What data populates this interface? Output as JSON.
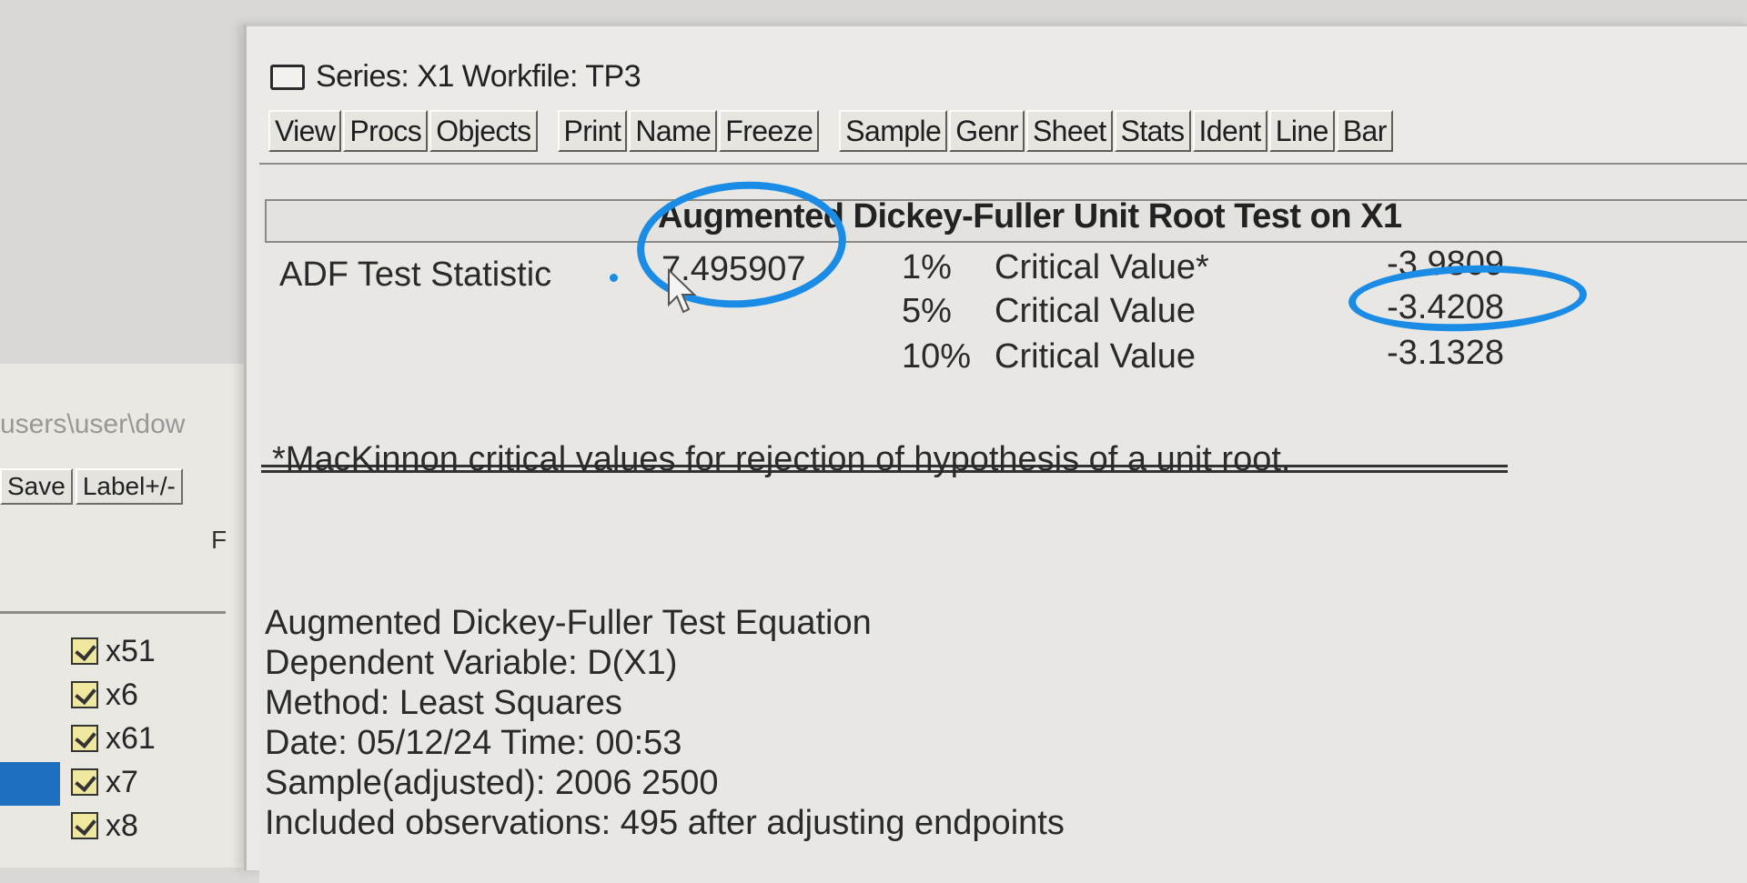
{
  "background_window": {
    "path": "users\\user\\dow",
    "toolbar": [
      "Save",
      "Label+/-"
    ],
    "cut_letter": "F",
    "items": [
      "x51",
      "x6",
      "x61",
      "x7",
      "x8"
    ]
  },
  "window": {
    "title": "Series: X1   Workfile: TP3",
    "toolbar": [
      [
        "View",
        "Procs",
        "Objects"
      ],
      [
        "Print",
        "Name",
        "Freeze"
      ],
      [
        "Sample",
        "Genr",
        "Sheet",
        "Stats",
        "Ident",
        "Line",
        "Bar"
      ]
    ]
  },
  "output": {
    "header": "Augmented Dickey-Fuller Unit Root Test on X1",
    "adf_label": "ADF Test Statistic",
    "adf_value": "7.495907",
    "critical": [
      {
        "pct": "1%",
        "label": "Critical Value*",
        "value": "-3.9809"
      },
      {
        "pct": "5%",
        "label": "Critical Value",
        "value": "-3.4208"
      },
      {
        "pct": "10%",
        "label": "Critical Value",
        "value": "-3.1328"
      }
    ],
    "footnote": "*MacKinnon critical values for rejection of hypothesis of a unit root.",
    "equation": {
      "title": "Augmented Dickey-Fuller Test Equation",
      "dependent": "Dependent Variable: D(X1)",
      "method": "Method: Least Squares",
      "datetime": "Date: 05/12/24   Time: 00:53",
      "sample": "Sample(adjusted): 2006 2500",
      "observations": "Included observations: 495 after adjusting endpoints"
    }
  },
  "annotations": {
    "color": "#1a8ce6"
  }
}
